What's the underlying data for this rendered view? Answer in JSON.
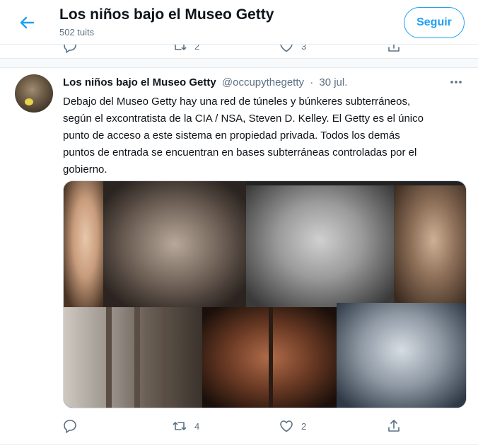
{
  "header": {
    "title": "Los niños bajo el Museo Getty",
    "subtitle": "502 tuits",
    "follow_label": "Seguir"
  },
  "previous_tweet": {
    "retweets": "2",
    "likes": "3"
  },
  "tweet": {
    "author_name": "Los niños bajo el Museo Getty",
    "handle": "@occupythegetty",
    "separator": "·",
    "time": "30 jul.",
    "text": "Debajo del Museo Getty hay una red de túneles y búnkeres subterráneos,\nsegún el excontratista de la CIA / NSA, Steven D. Kelley. El Getty es el único\npunto de acceso a este sistema en propiedad privada. Todos los demás\npuntos de entrada se encuentran en bases subterráneas controladas por el\ngobierno.",
    "replies": "",
    "retweets": "4",
    "likes": "2"
  },
  "colors": {
    "accent": "#1da1f2",
    "text": "#0f1419",
    "secondary": "#5b7083"
  },
  "icons": [
    "back-arrow-icon",
    "reply-icon",
    "retweet-icon",
    "like-icon",
    "share-icon",
    "more-icon"
  ]
}
